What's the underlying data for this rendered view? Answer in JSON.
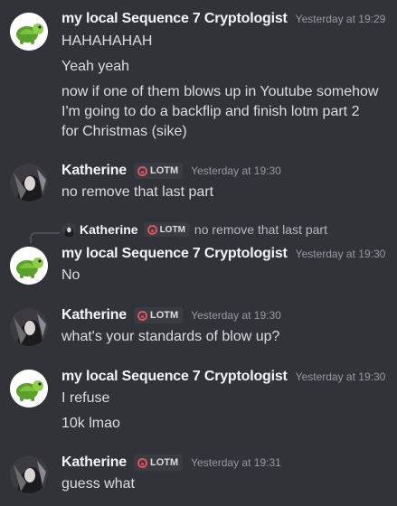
{
  "users": {
    "crypto": "my local Sequence 7 Cryptologist",
    "katherine": "Katherine",
    "tag": "LOTM"
  },
  "messages": {
    "g1": {
      "timestamp": "Yesterday at 19:29",
      "lines": [
        "HAHAHAHAH",
        "Yeah yeah",
        "now if one of them blows up in Youtube somehow",
        "I'm going to do a backflip and finish lotm part 2",
        "for Christmas (sike)"
      ]
    },
    "g2": {
      "timestamp": "Yesterday at 19:30",
      "lines": [
        "no remove that last part"
      ]
    },
    "reply": {
      "name": "Katherine",
      "text": "no remove that last part"
    },
    "g3": {
      "timestamp": "Yesterday at 19:30",
      "lines": [
        "No"
      ]
    },
    "g4": {
      "timestamp": "Yesterday at 19:30",
      "lines": [
        "what's your standards of blow up?"
      ]
    },
    "g5": {
      "timestamp": "Yesterday at 19:30",
      "lines": [
        "I refuse",
        "10k lmao"
      ]
    },
    "g6": {
      "timestamp": "Yesterday at 19:31",
      "lines": [
        "guess what"
      ]
    }
  },
  "colors": {
    "background": "#313338",
    "tag_accent": "#e0525f"
  },
  "icons": {
    "tag": "lotm-tag-icon"
  }
}
